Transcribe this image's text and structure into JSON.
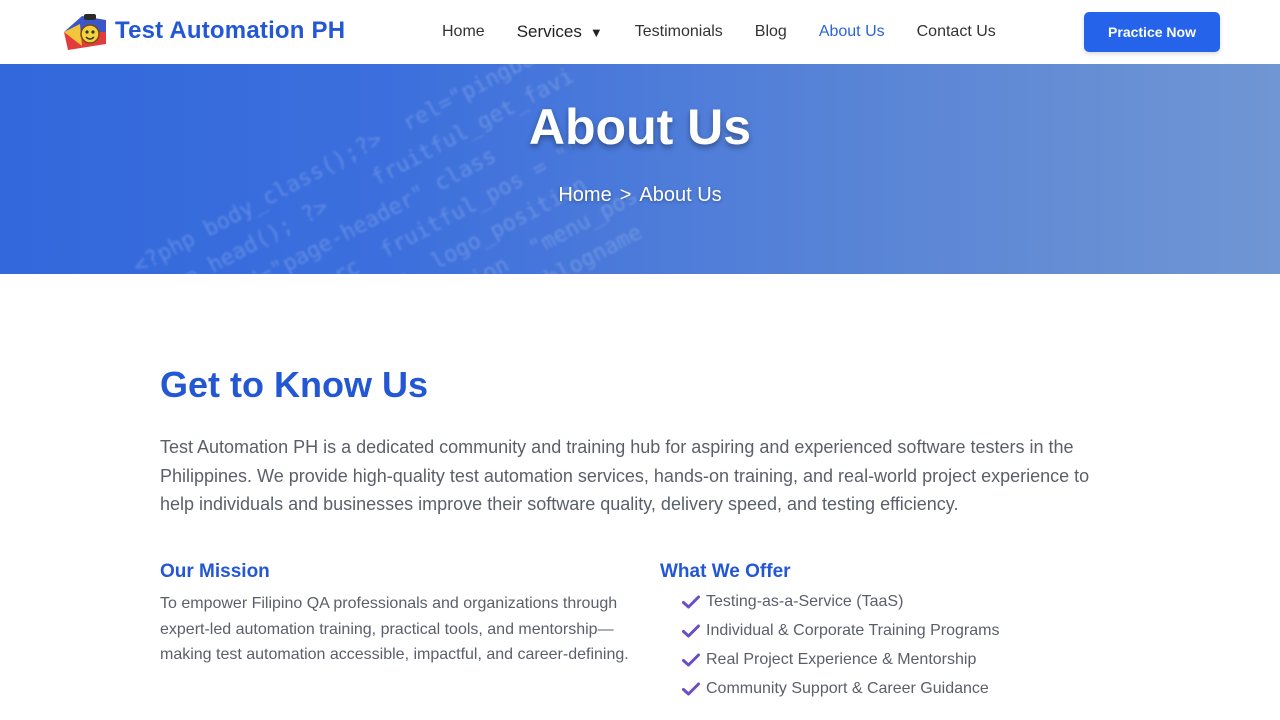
{
  "header": {
    "brand": "Test Automation PH",
    "nav": [
      {
        "label": "Home"
      },
      {
        "label": "Services"
      },
      {
        "label": "Testimonials"
      },
      {
        "label": "Blog"
      },
      {
        "label": "About Us"
      },
      {
        "label": "Contact Us"
      }
    ],
    "active_nav": "About Us",
    "cta_label": "Practice Now"
  },
  "hero": {
    "title": "About Us",
    "breadcrumb": {
      "home": "Home",
      "separator": ">",
      "current": "About Us"
    }
  },
  "main": {
    "title": "Get to Know Us",
    "intro": "Test Automation PH is a dedicated community and training hub for aspiring and experienced software testers in the Philippines. We provide high-quality test automation services, hands-on training, and real-world project experience to help individuals and businesses improve their software quality, delivery speed, and testing efficiency.",
    "mission": {
      "title": "Our Mission",
      "text": "To empower Filipino QA professionals and organizations through expert-led automation training, practical tools, and mentorship—making test automation accessible, impactful, and career-defining."
    },
    "offer": {
      "title": "What We Offer",
      "items": [
        "Testing-as-a-Service (TaaS)",
        "Individual & Corporate Training Programs",
        "Real Project Experience & Mentorship",
        "Community Support & Career Guidance"
      ]
    }
  },
  "colors": {
    "brand_blue": "#2357d4",
    "cta_blue": "#2563eb",
    "check_purple": "#6a4fc4",
    "body_text": "#5a5f6a"
  },
  "icons": {
    "caret": "caret-down-icon",
    "check": "check-icon",
    "logo": "brand-logo-icon"
  }
}
